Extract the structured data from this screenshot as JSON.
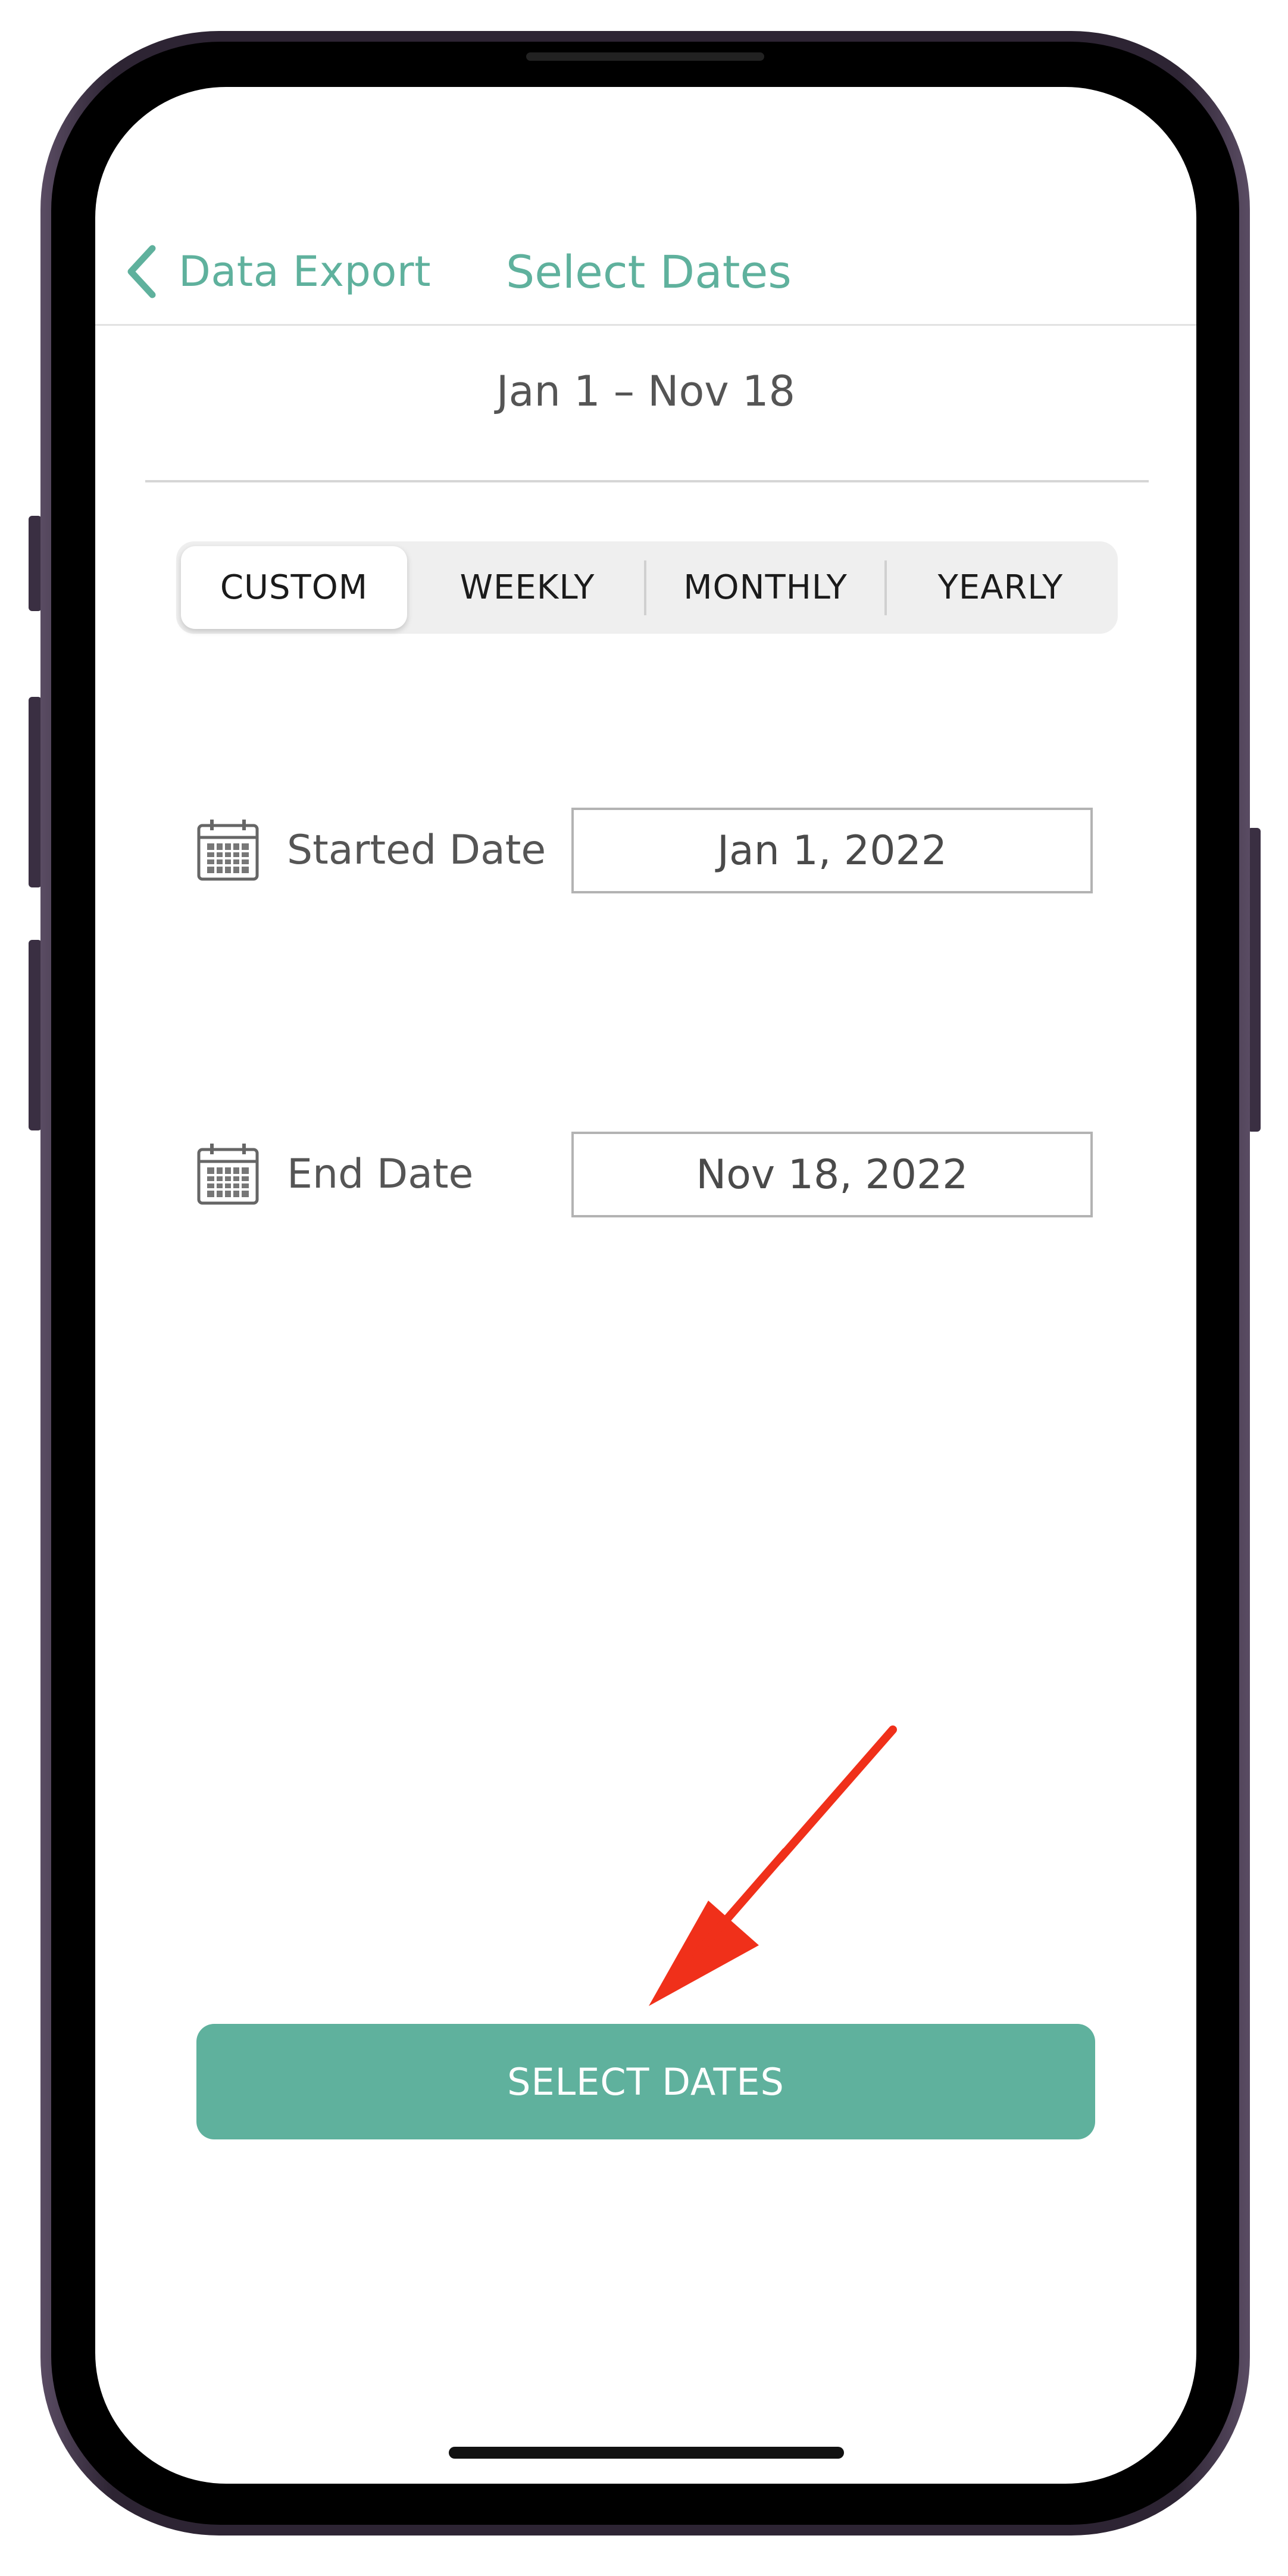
{
  "nav": {
    "back_label": "Data Export",
    "title": "Select Dates"
  },
  "range_summary": "Jan 1 – Nov 18",
  "segments": [
    {
      "label": "CUSTOM",
      "selected": true
    },
    {
      "label": "WEEKLY",
      "selected": false
    },
    {
      "label": "MONTHLY",
      "selected": false
    },
    {
      "label": "YEARLY",
      "selected": false
    }
  ],
  "start": {
    "label": "Started Date",
    "value": "Jan 1, 2022",
    "icon": "calendar-icon"
  },
  "end": {
    "label": "End Date",
    "value": "Nov 18, 2022",
    "icon": "calendar-icon"
  },
  "primary_button": "SELECT DATES",
  "colors": {
    "accent": "#5fb19d",
    "annotation_arrow": "#f0301a"
  }
}
